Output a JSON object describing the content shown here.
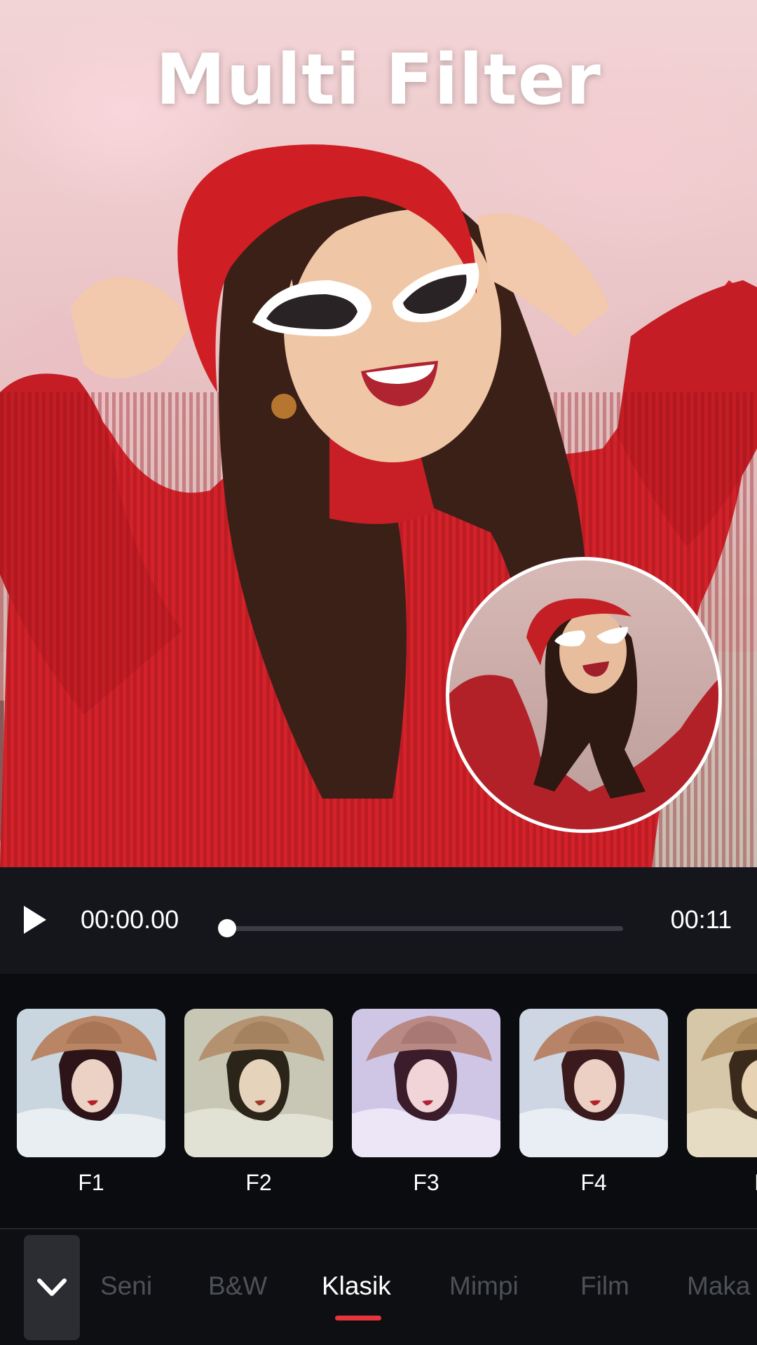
{
  "header": {
    "title": "Multi Filter"
  },
  "player": {
    "current_time": "00:00.00",
    "total_time": "00:11",
    "progress": 0
  },
  "filters": [
    {
      "label": "F1",
      "tint": "#c9d6e0"
    },
    {
      "label": "F2",
      "tint": "#c8c7b6"
    },
    {
      "label": "F3",
      "tint": "#cfc6e6"
    },
    {
      "label": "F4",
      "tint": "#cdd6e2"
    },
    {
      "label": "F",
      "tint": "#d6c7a9"
    }
  ],
  "tabs": {
    "items": [
      "Seni",
      "B&W",
      "Klasik",
      "Mimpi",
      "Film",
      "Maka"
    ],
    "active": "Klasik"
  },
  "colors": {
    "accent": "#e8343c",
    "sweater": "#d4222a",
    "player_bg": "#14161b",
    "tab_inactive": "#4d5058"
  },
  "icons": [
    "play-icon",
    "chevron-down-icon"
  ]
}
